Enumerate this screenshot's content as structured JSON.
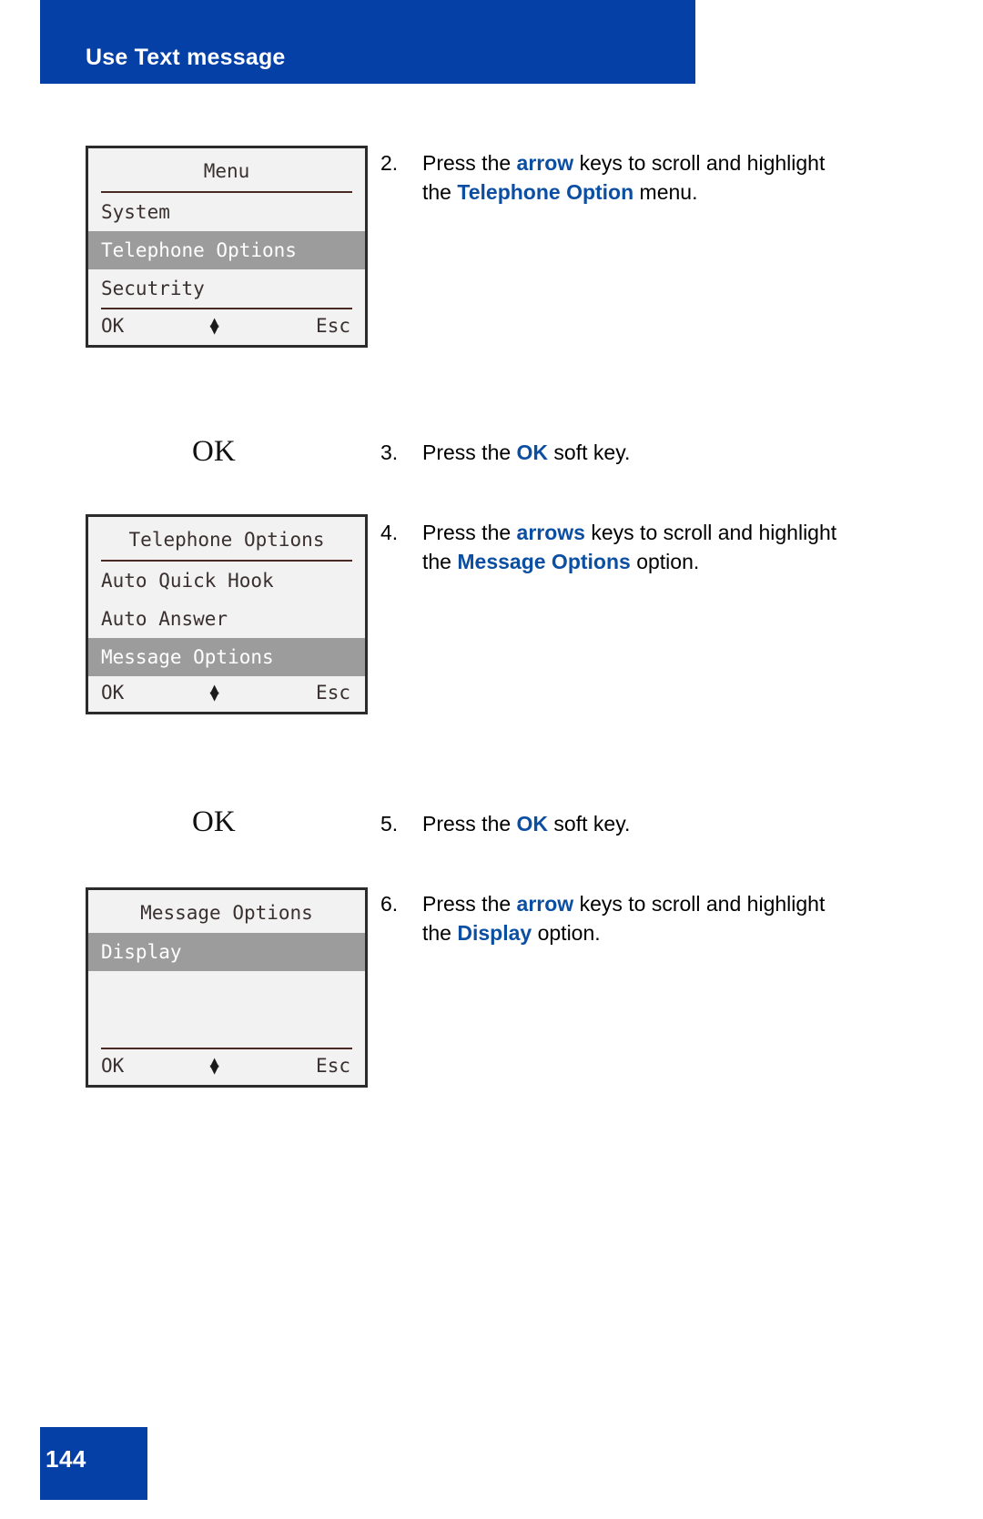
{
  "page": {
    "header_title": "Use Text message",
    "page_number": "144",
    "accent_color": "#0540a6",
    "link_color": "#0b4ea2",
    "highlight_color": "#9c9c9c"
  },
  "screens": [
    {
      "title": "Menu",
      "items": [
        {
          "label": "System",
          "selected": false
        },
        {
          "label": "Telephone Options",
          "selected": true
        },
        {
          "label": "Secutrity",
          "selected": false
        }
      ],
      "softkey_left": "OK",
      "softkey_right": "Esc",
      "nav_icon": "up-down-arrow-icon"
    },
    {
      "title": "Telephone Options",
      "items": [
        {
          "label": "Auto Quick Hook",
          "selected": false
        },
        {
          "label": "Auto Answer",
          "selected": false
        },
        {
          "label": "Message Options",
          "selected": true
        }
      ],
      "softkey_left": "OK",
      "softkey_right": "Esc",
      "nav_icon": "up-down-arrow-icon"
    },
    {
      "title": "Message Options",
      "items": [
        {
          "label": "Display",
          "selected": true
        },
        {
          "label": "",
          "selected": false
        },
        {
          "label": "",
          "selected": false
        }
      ],
      "softkey_left": "OK",
      "softkey_right": "Esc",
      "nav_icon": "up-down-arrow-icon"
    }
  ],
  "softkey_captions": [
    {
      "label": "OK"
    },
    {
      "label": "OK"
    }
  ],
  "steps": [
    {
      "number": "2.",
      "line1_pre": "Press the ",
      "line1_bold": "arrow",
      "line1_post": " keys to scroll and",
      "line2_pre": "highlight the ",
      "line2_bold": "Telephone Option",
      "line2_post": " menu."
    },
    {
      "number": "3.",
      "line1_pre": "Press the ",
      "line1_bold": "OK",
      "line1_post": " soft key.",
      "line2_pre": "",
      "line2_bold": "",
      "line2_post": ""
    },
    {
      "number": "4.",
      "line1_pre": "Press the ",
      "line1_bold": "arrows",
      "line1_post": " keys to scroll and",
      "line2_pre": "highlight the ",
      "line2_bold": "Message Options",
      "line2_post": " option."
    },
    {
      "number": "5.",
      "line1_pre": "Press the ",
      "line1_bold": "OK",
      "line1_post": " soft key.",
      "line2_pre": "",
      "line2_bold": "",
      "line2_post": ""
    },
    {
      "number": "6.",
      "line1_pre": "Press the ",
      "line1_bold": "arrow",
      "line1_post": " keys to scroll and",
      "line2_pre": "highlight the ",
      "line2_bold": "Display",
      "line2_post": " option."
    }
  ]
}
